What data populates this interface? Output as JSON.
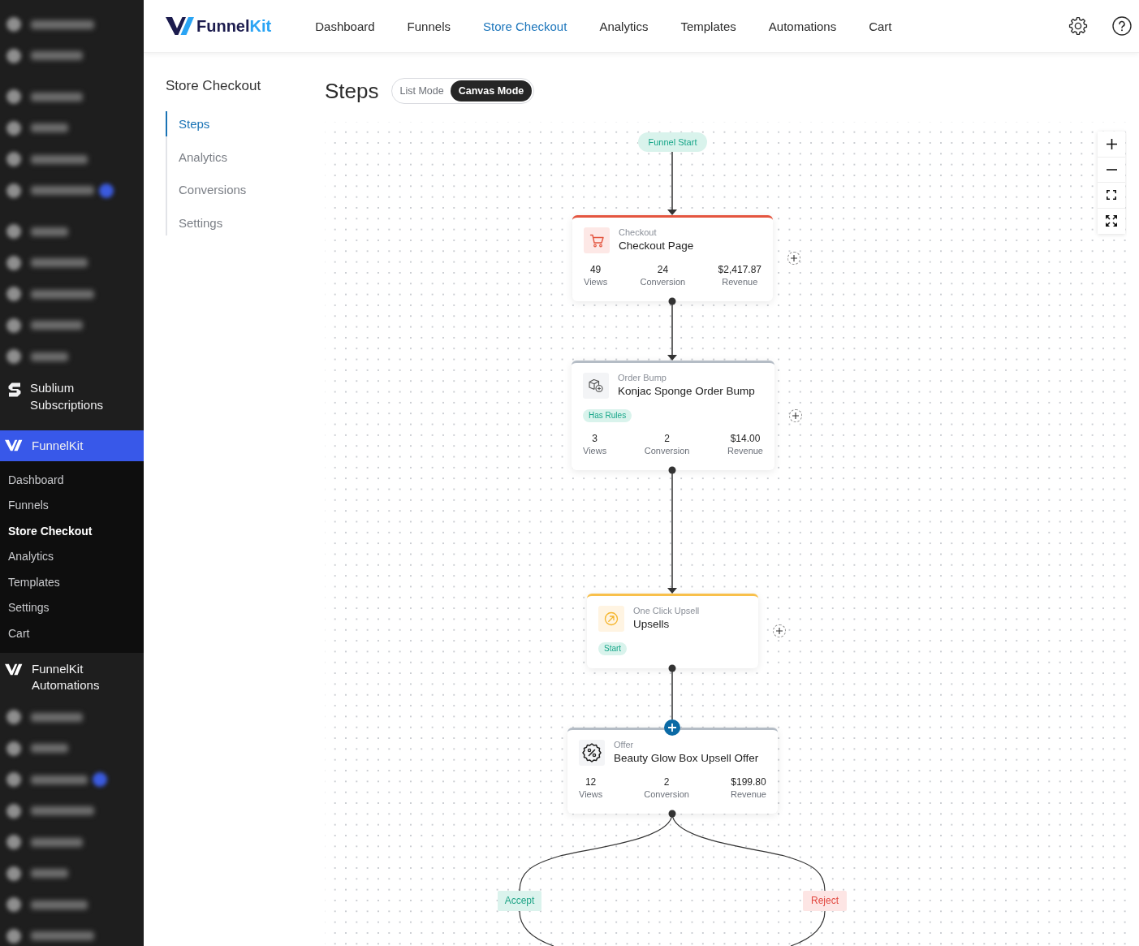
{
  "admin_menu": {
    "blurred_top": [
      {
        "items": [
          {
            "badge": false
          },
          {
            "badge": false
          }
        ]
      },
      {
        "items": [
          {
            "badge": false
          },
          {
            "badge": false
          },
          {
            "badge": false
          },
          {
            "badge": true
          }
        ]
      },
      {
        "items": [
          {
            "badge": false
          },
          {
            "badge": false
          },
          {
            "badge": false
          },
          {
            "badge": false
          },
          {
            "badge": false
          }
        ]
      }
    ],
    "sublium": {
      "label": "Sublium Subscriptions"
    },
    "funnelkit": {
      "label": "FunnelKit",
      "selected": true,
      "submenu": [
        {
          "label": "Dashboard",
          "selected": false
        },
        {
          "label": "Funnels",
          "selected": false
        },
        {
          "label": "Store Checkout",
          "selected": true
        },
        {
          "label": "Analytics",
          "selected": false
        },
        {
          "label": "Templates",
          "selected": false
        },
        {
          "label": "Settings",
          "selected": false
        },
        {
          "label": "Cart",
          "selected": false
        }
      ]
    },
    "automations": {
      "label": "FunnelKit Automations"
    },
    "blurred_bottom": [
      {
        "badge": false
      },
      {
        "badge": false
      },
      {
        "badge": true
      },
      {
        "badge": false
      },
      {
        "badge": false
      },
      {
        "badge": false
      },
      {
        "badge": false
      },
      {
        "badge": false
      }
    ]
  },
  "top_bar": {
    "logo": {
      "name": "Funnel",
      "accent": "Kit"
    },
    "nav": [
      {
        "label": "Dashboard",
        "selected": false
      },
      {
        "label": "Funnels",
        "selected": false
      },
      {
        "label": "Store Checkout",
        "selected": true
      },
      {
        "label": "Analytics",
        "selected": false
      },
      {
        "label": "Templates",
        "selected": false
      },
      {
        "label": "Automations",
        "selected": false
      },
      {
        "label": "Cart",
        "selected": false
      }
    ]
  },
  "page_nav": {
    "title": "Store Checkout",
    "items": [
      {
        "label": "Steps",
        "selected": true
      },
      {
        "label": "Analytics",
        "selected": false
      },
      {
        "label": "Conversions",
        "selected": false
      },
      {
        "label": "Settings",
        "selected": false
      }
    ]
  },
  "main": {
    "title": "Steps",
    "view_modes": [
      {
        "label": "List Mode",
        "selected": false
      },
      {
        "label": "Canvas Mode",
        "selected": true
      }
    ]
  },
  "canvas": {
    "start": "Funnel Start",
    "steps": [
      {
        "kind": "checkout",
        "type_label": "Checkout",
        "title": "Checkout Page",
        "stats": [
          {
            "value": "49",
            "label": "Views"
          },
          {
            "value": "24",
            "label": "Conversion"
          },
          {
            "value": "$2,417.87",
            "label": "Revenue"
          }
        ],
        "add_button": true,
        "hovered": false
      },
      {
        "kind": "bump",
        "type_label": "Order Bump",
        "title": "Konjac Sponge Order Bump",
        "tag": "Has Rules",
        "stats": [
          {
            "value": "3",
            "label": "Views"
          },
          {
            "value": "2",
            "label": "Conversion"
          },
          {
            "value": "$14.00",
            "label": "Revenue"
          }
        ],
        "add_button": true,
        "hovered": false
      },
      {
        "kind": "upsell",
        "type_label": "One Click Upsell",
        "title": "Upsells",
        "tag": "Start",
        "add_button": true,
        "hovered": false
      },
      {
        "kind": "offer",
        "type_label": "Offer",
        "title": "Beauty Glow Box Upsell Offer",
        "stats": [
          {
            "value": "12",
            "label": "Views"
          },
          {
            "value": "2",
            "label": "Conversion"
          },
          {
            "value": "$199.80",
            "label": "Revenue"
          }
        ],
        "add_button": false,
        "hovered": true
      }
    ],
    "branches": [
      {
        "kind": "accept",
        "label": "Accept"
      },
      {
        "kind": "reject",
        "label": "Reject"
      }
    ]
  }
}
